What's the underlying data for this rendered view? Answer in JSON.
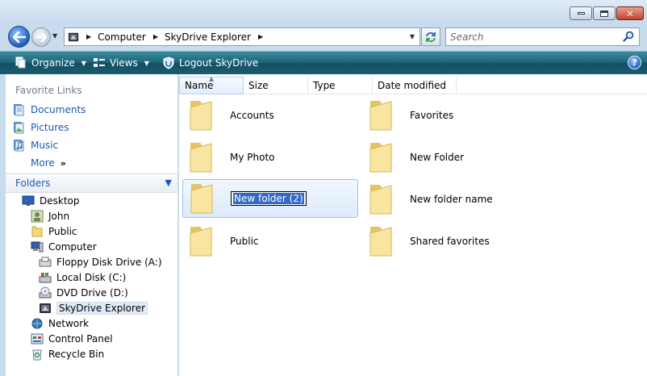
{
  "window": {
    "controls": {
      "minimize": "minimize-icon",
      "maximize": "maximize-icon",
      "close": "close-icon"
    }
  },
  "address_bar": {
    "crumbs": [
      "Computer",
      "SkyDrive Explorer"
    ],
    "search_placeholder": "Search"
  },
  "toolbar": {
    "organize": "Organize",
    "views": "Views",
    "logout": "Logout SkyDrive",
    "help": "?"
  },
  "favorite_links": {
    "header": "Favorite Links",
    "items": [
      "Documents",
      "Pictures",
      "Music"
    ],
    "more": "More",
    "more_arrows": "»"
  },
  "folders_pane": {
    "header": "Folders",
    "tree": [
      {
        "label": "Desktop",
        "icon": "desktop-icon"
      },
      {
        "label": "John",
        "icon": "user-folder-icon"
      },
      {
        "label": "Public",
        "icon": "folder-icon"
      },
      {
        "label": "Computer",
        "icon": "computer-icon"
      },
      {
        "label": "Floppy Disk Drive (A:)",
        "icon": "floppy-drive-icon"
      },
      {
        "label": "Local Disk (C:)",
        "icon": "hard-disk-icon"
      },
      {
        "label": "DVD Drive (D:)",
        "icon": "dvd-drive-icon"
      },
      {
        "label": "SkyDrive Explorer",
        "icon": "skydrive-icon"
      },
      {
        "label": "Network",
        "icon": "network-icon"
      },
      {
        "label": "Control Panel",
        "icon": "control-panel-icon"
      },
      {
        "label": "Recycle Bin",
        "icon": "recycle-bin-icon"
      }
    ]
  },
  "columns": [
    "Name",
    "Size",
    "Type",
    "Date modified"
  ],
  "items": [
    "Accounts",
    "Favorites",
    "My Photo",
    "New Folder",
    "New folder (2)",
    "New folder name",
    "Public",
    "Shared favorites"
  ],
  "colors": {
    "toolbar": "#1d6478",
    "link": "#1a58b8",
    "selection": "#3169c6"
  }
}
